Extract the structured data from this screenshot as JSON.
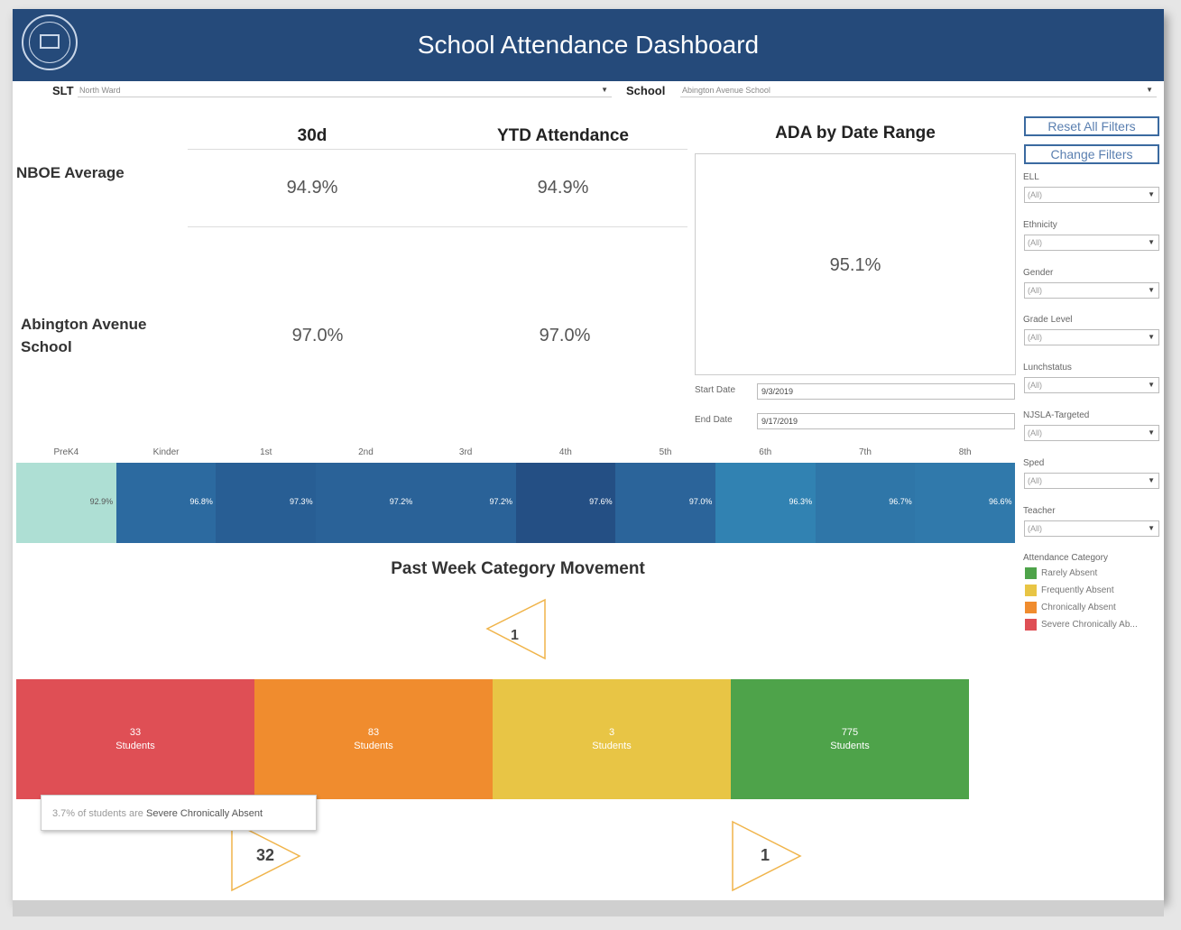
{
  "header": {
    "title": "School Attendance Dashboard"
  },
  "top_filters": {
    "slt_label": "SLT",
    "slt_value": "North Ward",
    "school_label": "School",
    "school_value": "Abington Avenue School"
  },
  "summary": {
    "col_30d": "30d",
    "col_ytd": "YTD Attendance",
    "nboe_label": "NBOE Average",
    "nboe_30d": "94.9%",
    "nboe_ytd": "94.9%",
    "school_label_line1": "Abington Avenue",
    "school_label_line2": "School",
    "school_30d": "97.0%",
    "school_ytd": "97.0%"
  },
  "ada": {
    "title": "ADA by Date Range",
    "value": "95.1%",
    "start_label": "Start Date",
    "start_value": "9/3/2019",
    "end_label": "End Date",
    "end_value": "9/17/2019"
  },
  "buttons": {
    "reset": "Reset All Filters",
    "change": "Change Filters"
  },
  "side_filters": [
    {
      "label": "ELL",
      "value": "(All)"
    },
    {
      "label": "Ethnicity",
      "value": "(All)"
    },
    {
      "label": "Gender",
      "value": "(All)"
    },
    {
      "label": "Grade Level",
      "value": "(All)"
    },
    {
      "label": "Lunchstatus",
      "value": "(All)"
    },
    {
      "label": "NJSLA-Targeted",
      "value": "(All)"
    },
    {
      "label": "Sped",
      "value": "(All)"
    },
    {
      "label": "Teacher",
      "value": "(All)"
    }
  ],
  "legend": {
    "title": "Attendance Category",
    "items": [
      {
        "label": "Rarely Absent",
        "color": "#4ea34a"
      },
      {
        "label": "Frequently Absent",
        "color": "#e8c545"
      },
      {
        "label": "Chronically Absent",
        "color": "#f08c2e"
      },
      {
        "label": "Severe Chronically Ab...",
        "color": "#df4f55"
      }
    ]
  },
  "grades": [
    {
      "label": "PreK4",
      "value": "92.9%",
      "color": "#aedfd4"
    },
    {
      "label": "Kinder",
      "value": "96.8%",
      "color": "#2c6aa0"
    },
    {
      "label": "1st",
      "value": "97.3%",
      "color": "#285e94"
    },
    {
      "label": "2nd",
      "value": "97.2%",
      "color": "#2a6298"
    },
    {
      "label": "3rd",
      "value": "97.2%",
      "color": "#2a6298"
    },
    {
      "label": "4th",
      "value": "97.6%",
      "color": "#244f84"
    },
    {
      "label": "5th",
      "value": "97.0%",
      "color": "#2b649a"
    },
    {
      "label": "6th",
      "value": "96.3%",
      "color": "#3182b2"
    },
    {
      "label": "7th",
      "value": "96.7%",
      "color": "#2f76a8"
    },
    {
      "label": "8th",
      "value": "96.6%",
      "color": "#3079ab"
    }
  ],
  "movement": {
    "title": "Past Week Category Movement",
    "top_triangle": "1",
    "left_triangle": "32",
    "right_triangle": "1"
  },
  "categories": [
    {
      "count": "33",
      "unit": "Students",
      "color": "#df4f55"
    },
    {
      "count": "83",
      "unit": "Students",
      "color": "#f08c2e"
    },
    {
      "count": "3",
      "unit": "Students",
      "color": "#e8c545"
    },
    {
      "count": "775",
      "unit": "Students",
      "color": "#4ea34a"
    }
  ],
  "tooltip": {
    "pct": "3.7%",
    "mid": "of students are",
    "category": "Severe Chronically Absent"
  }
}
